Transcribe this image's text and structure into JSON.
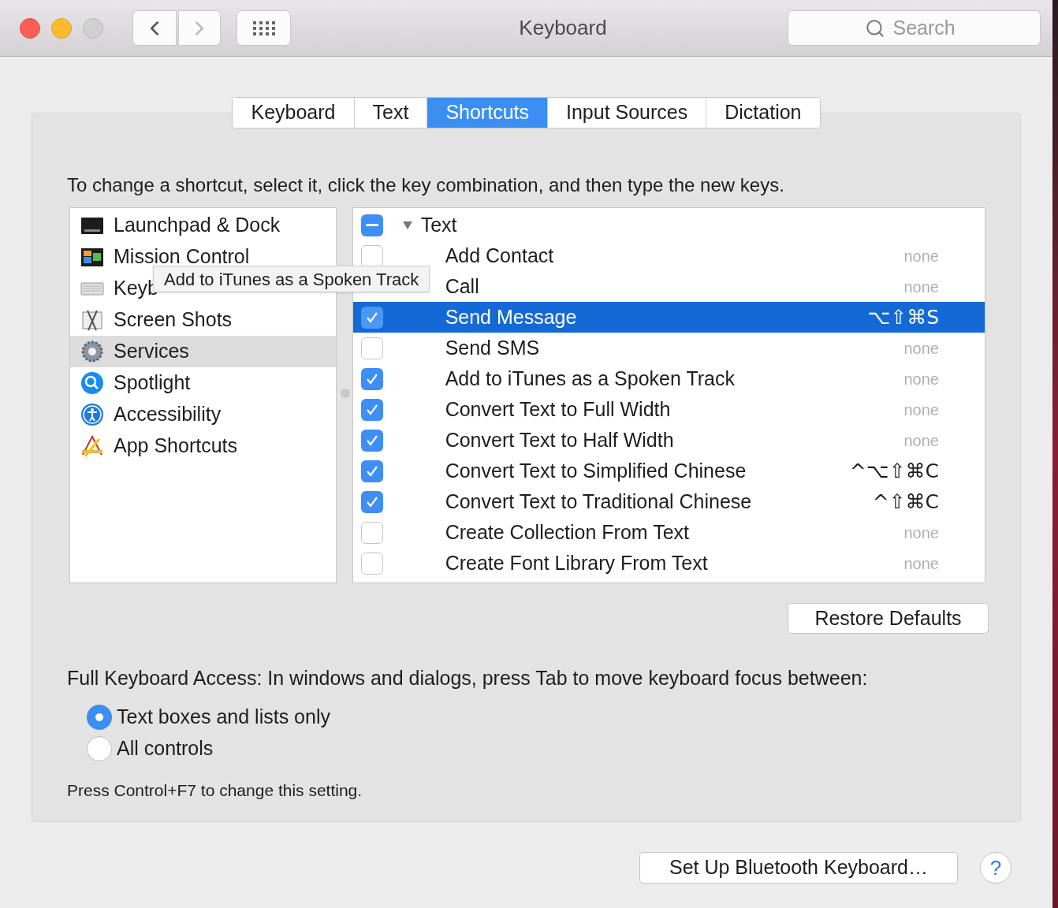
{
  "window": {
    "title": "Keyboard",
    "search": {
      "placeholder": "Search"
    }
  },
  "tabs": [
    {
      "label": "Keyboard",
      "selected": false
    },
    {
      "label": "Text",
      "selected": false
    },
    {
      "label": "Shortcuts",
      "selected": true
    },
    {
      "label": "Input Sources",
      "selected": false
    },
    {
      "label": "Dictation",
      "selected": false
    }
  ],
  "instruction": "To change a shortcut, select it, click the key combination, and then type the new keys.",
  "categories": [
    {
      "label": "Launchpad & Dock",
      "kind": "dock",
      "selected": false
    },
    {
      "label": "Mission Control",
      "kind": "mission",
      "selected": false
    },
    {
      "label": "Keyb",
      "kind": "keyboard",
      "selected": false
    },
    {
      "label": "Screen Shots",
      "kind": "screenshot",
      "selected": false
    },
    {
      "label": "Services",
      "kind": "gear",
      "selected": true
    },
    {
      "label": "Spotlight",
      "kind": "spotlight",
      "selected": false
    },
    {
      "label": "Accessibility",
      "kind": "accessibility",
      "selected": false
    },
    {
      "label": "App Shortcuts",
      "kind": "appshortcuts",
      "selected": false
    }
  ],
  "tooltip": "Add to iTunes as a Spoken Track",
  "shortcuts": {
    "group": {
      "label": "Text",
      "expanded": true,
      "mixed": true
    },
    "items": [
      {
        "name": "Add Contact",
        "checked": false,
        "selected": false,
        "shortcut": "none",
        "assigned": false
      },
      {
        "name": "Call",
        "selected": false,
        "shortcut": "none",
        "assigned": false
      },
      {
        "name": "Send Message",
        "checked": true,
        "selected": true,
        "shortcut": "⌥⇧⌘S",
        "assigned": true
      },
      {
        "name": "Send SMS",
        "checked": false,
        "selected": false,
        "shortcut": "none",
        "assigned": false
      },
      {
        "name": "Add to iTunes as a Spoken Track",
        "checked": true,
        "selected": false,
        "shortcut": "none",
        "assigned": false
      },
      {
        "name": "Convert Text to Full Width",
        "checked": true,
        "selected": false,
        "shortcut": "none",
        "assigned": false
      },
      {
        "name": "Convert Text to Half Width",
        "checked": true,
        "selected": false,
        "shortcut": "none",
        "assigned": false
      },
      {
        "name": "Convert Text to Simplified Chinese",
        "checked": true,
        "selected": false,
        "shortcut": "^⌥⇧⌘C",
        "assigned": true
      },
      {
        "name": "Convert Text to Traditional Chinese",
        "checked": true,
        "selected": false,
        "shortcut": "^⇧⌘C",
        "assigned": true
      },
      {
        "name": "Create Collection From Text",
        "checked": false,
        "selected": false,
        "shortcut": "none",
        "assigned": false
      },
      {
        "name": "Create Font Library From Text",
        "checked": false,
        "selected": false,
        "shortcut": "none",
        "assigned": false
      }
    ]
  },
  "restore_button": "Restore Defaults",
  "full_keyboard_access": {
    "label": "Full Keyboard Access: In windows and dialogs, press Tab to move keyboard focus between:",
    "options": [
      {
        "label": "Text boxes and lists only",
        "selected": true
      },
      {
        "label": "All controls",
        "selected": false
      }
    ],
    "hint": "Press Control+F7 to change this setting."
  },
  "bluetooth_button": "Set Up Bluetooth Keyboard…",
  "help_button": "?"
}
